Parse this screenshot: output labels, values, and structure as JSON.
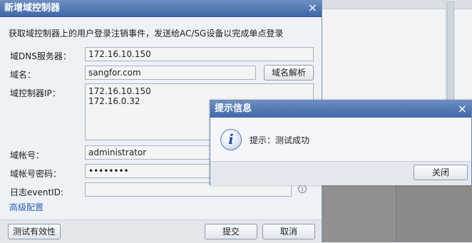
{
  "dialog": {
    "title": "新增域控制器",
    "close_label": "×",
    "description": "获取域控制器上的用户登录注销事件，发送给AC/SG设备以完成单点登录",
    "fields": {
      "dns_label": "域DNS服务器：",
      "dns_value": "172.16.10.150",
      "domain_label": "域名：",
      "domain_value": "sangfor.com",
      "resolve_button": "域名解析",
      "dc_ip_label": "域控制器IP：",
      "dc_ip_value": "172.16.10.150\n172.16.0.32",
      "account_label": "域帐号：",
      "account_value": "administrator",
      "password_label": "域帐号密码：",
      "password_value": "••••••••",
      "event_id_label": "日志eventID:",
      "event_id_value": ""
    },
    "advanced_link": "高级配置",
    "buttons": {
      "test": "测试有效性",
      "submit": "提交",
      "cancel": "取消"
    }
  },
  "message_box": {
    "title": "提示信息",
    "close_label": "×",
    "icon": "information-icon",
    "text": "提示：测试成功",
    "ok_button": "关闭"
  },
  "colors": {
    "titlebar_top": "#6d8fc2",
    "titlebar_bottom": "#3e68a8",
    "link": "#2b62b6",
    "dialog_bg": "#eef1f5"
  }
}
